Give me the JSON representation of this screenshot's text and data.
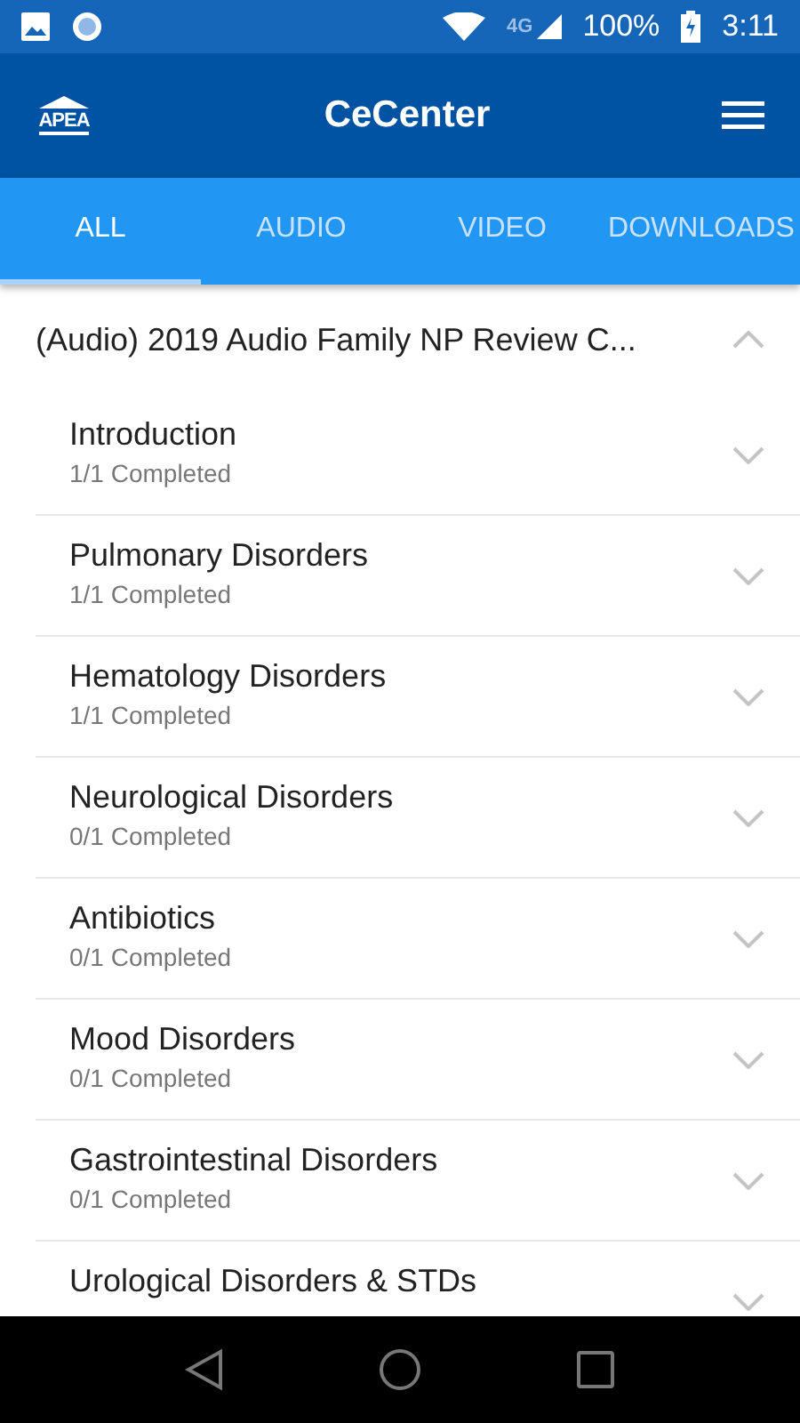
{
  "status_bar": {
    "network": "4G",
    "battery": "100%",
    "time": "3:11"
  },
  "app_bar": {
    "logo_text": "APEA",
    "title": "CeCenter"
  },
  "tabs": [
    {
      "label": "ALL",
      "selected": true
    },
    {
      "label": "AUDIO",
      "selected": false
    },
    {
      "label": "VIDEO",
      "selected": false
    },
    {
      "label": "DOWNLOADS",
      "selected": false
    }
  ],
  "course": {
    "title": "(Audio) 2019 Audio Family NP Review C...",
    "expanded": true,
    "sections": [
      {
        "title": "Introduction",
        "subtitle": "1/1 Completed",
        "expanded": false
      },
      {
        "title": "Pulmonary Disorders",
        "subtitle": "1/1 Completed",
        "expanded": false
      },
      {
        "title": "Hematology Disorders",
        "subtitle": "1/1 Completed",
        "expanded": false
      },
      {
        "title": "Neurological Disorders",
        "subtitle": "0/1 Completed",
        "expanded": false
      },
      {
        "title": "Antibiotics",
        "subtitle": "0/1 Completed",
        "expanded": false
      },
      {
        "title": "Mood Disorders",
        "subtitle": "0/1 Completed",
        "expanded": false
      },
      {
        "title": "Gastrointestinal Disorders",
        "subtitle": "0/1 Completed",
        "expanded": false
      },
      {
        "title": "Urological Disorders & STDs",
        "expanded": false
      }
    ]
  }
}
